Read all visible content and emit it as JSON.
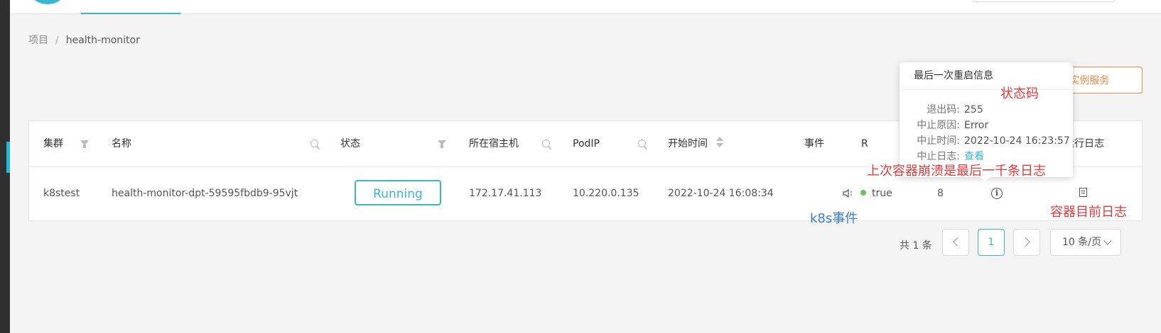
{
  "breadcrumb": {
    "root": "项目",
    "sep": "/",
    "current": "health-monitor"
  },
  "actions": {
    "stop_label": "止实例服务"
  },
  "table": {
    "headers": {
      "cluster": "集群",
      "name": "名称",
      "status": "状态",
      "host": "所在宿主机",
      "podip": "PodIP",
      "start_time": "开始时间",
      "events": "事件",
      "ready": "R",
      "logs": "运行日志"
    },
    "row": {
      "cluster": "k8stest",
      "name": "health-monitor-dpt-59595fbdb9-95vjt",
      "status": "Running",
      "host": "172.17.41.113",
      "podip": "10.220.0.135",
      "start_time": "2022-10-24 16:08:34",
      "ready": "true",
      "restarts": "8"
    }
  },
  "pagination": {
    "total": "共 1 条",
    "current_page": "1",
    "page_size": "10 条/页"
  },
  "popover": {
    "title": "最后一次重启信息",
    "exit_code_label": "退出码:",
    "exit_code": "255",
    "reason_label": "中止原因:",
    "reason": "Error",
    "time_label": "中止时间:",
    "time": "2022-10-24 16:23:57",
    "log_label": "中止日志:",
    "log_link": "查看"
  },
  "annotations": {
    "status_code": "状态码",
    "last_crash_logs": "上次容器崩溃是最后一千条日志",
    "k8s_events": "k8s事件",
    "current_logs": "容器目前日志"
  },
  "colors": {
    "accent": "#3bb6d2",
    "warning": "#f08b4a",
    "annotation_red": "#e83a3a",
    "annotation_blue": "#3b7bd8",
    "ok_dot": "#6ac259"
  },
  "icons": [
    "filter-icon",
    "search-icon",
    "sort-icon",
    "speaker-icon",
    "info-icon",
    "log-icon",
    "chevron-left-icon",
    "chevron-right-icon",
    "chevron-down-icon"
  ]
}
